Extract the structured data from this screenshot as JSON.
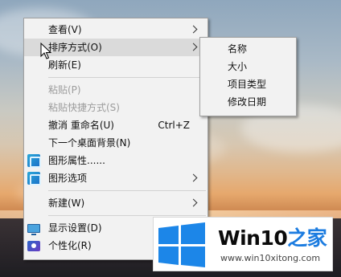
{
  "context_menu": {
    "items": [
      {
        "label": "查看(V)",
        "submenu": true
      },
      {
        "label": "排序方式(O)",
        "submenu": true,
        "highlighted": true
      },
      {
        "label": "刷新(E)"
      },
      {
        "label": "粘贴(P)",
        "disabled": true
      },
      {
        "label": "粘贴快捷方式(S)",
        "disabled": true
      },
      {
        "label": "撤消 重命名(U)",
        "shortcut": "Ctrl+Z"
      },
      {
        "label": "下一个桌面背景(N)"
      },
      {
        "label": "图形属性......",
        "icon": "graphics-icon"
      },
      {
        "label": "图形选项",
        "icon": "graphics-icon",
        "submenu": true
      },
      {
        "label": "新建(W)",
        "submenu": true
      },
      {
        "label": "显示设置(D)",
        "icon": "display-icon"
      },
      {
        "label": "个性化(R)",
        "icon": "personalize-icon"
      }
    ]
  },
  "sort_submenu": {
    "items": [
      "名称",
      "大小",
      "项目类型",
      "修改日期"
    ]
  },
  "watermark": {
    "brand_prefix": "Win10",
    "brand_suffix": "之家",
    "url": "www.win10xitong.com"
  },
  "colors": {
    "menu_bg": "#f2f2f2",
    "highlight": "#dadada",
    "disabled_text": "#9c9c9c",
    "logo_blue": "#1c7ce0"
  }
}
